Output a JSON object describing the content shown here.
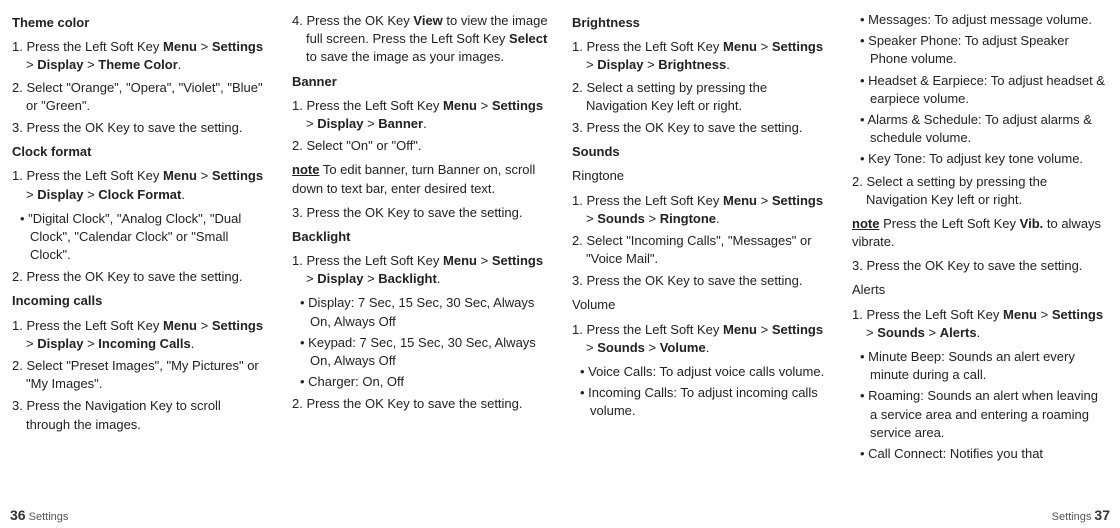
{
  "col1": {
    "themeColor": {
      "heading": "Theme color",
      "s1a": "1. Press the Left Soft Key ",
      "s1b": "Menu",
      "s1c": "Settings",
      "s1d": "Display",
      "s1e": "Theme Color",
      "s2": "2. Select \"Orange\", \"Opera\", \"Violet\", \"Blue\" or \"Green\".",
      "s3": "3. Press the OK Key to save the setting."
    },
    "clockFormat": {
      "heading": "Clock format",
      "s1a": "1. Press the Left Soft Key ",
      "s1b": "Menu",
      "s1c": "Settings",
      "s1d": "Display",
      "s1e": "Clock Format",
      "b1": "\"Digital Clock\", \"Analog Clock\", \"Dual Clock\", \"Calendar Clock\" or \"Small Clock\".",
      "s2": "2. Press the OK Key to save the setting."
    },
    "incoming": {
      "heading": "Incoming calls",
      "s1a": "1. Press the Left Soft Key ",
      "s1b": "Menu",
      "s1c": "Settings",
      "s1d": "Display",
      "s1e": "Incoming Calls",
      "s2": "2. Select \"Preset Images\", \"My Pictures\" or \"My Images\".",
      "s3": "3. Press the Navigation Key to scroll through the images."
    },
    "footerNum": "36",
    "footerText": "Settings"
  },
  "col2": {
    "s4a": "4. Press the OK Key ",
    "s4b": "View",
    "s4c": " to view the image full screen. Press the Left Soft Key ",
    "s4d": "Select",
    "s4e": " to save the image as your images.",
    "banner": {
      "heading": "Banner",
      "s1a": "1. Press the Left Soft Key ",
      "s1b": "Menu",
      "s1c": "Settings",
      "s1d": "Display",
      "s1e": "Banner",
      "s2": "2. Select \"On\" or \"Off\".",
      "noteLabel": "note",
      "noteText": " To edit banner, turn Banner on, scroll down to text bar, enter desired text.",
      "s3": "3. Press the OK Key to save the setting."
    },
    "backlight": {
      "heading": "Backlight",
      "s1a": "1. Press the Left Soft Key ",
      "s1b": "Menu",
      "s1c": "Settings",
      "s1d": "Display",
      "s1e": "Backlight",
      "b1": "Display: 7 Sec, 15 Sec, 30 Sec, Always On, Always Off",
      "b2": "Keypad: 7 Sec, 15 Sec, 30 Sec, Always On, Always Off",
      "b3": "Charger: On, Off",
      "s2": "2. Press the OK Key to save the setting."
    }
  },
  "col3": {
    "brightness": {
      "heading": "Brightness",
      "s1a": "1. Press the Left Soft Key ",
      "s1b": "Menu",
      "s1c": "Settings",
      "s1d": "Display",
      "s1e": "Brightness",
      "s2": "2. Select a setting by pressing the Navigation Key left or right.",
      "s3": "3. Press the OK Key to save the setting."
    },
    "sounds": {
      "heading": "Sounds"
    },
    "ringtone": {
      "heading": "Ringtone",
      "s1a": "1. Press the Left Soft Key ",
      "s1b": "Menu",
      "s1c": "Settings",
      "s1d": "Sounds",
      "s1e": "Ringtone",
      "s2": "2. Select \"Incoming Calls\", \"Messages\" or \"Voice Mail\".",
      "s3": "3. Press the OK Key to save the setting."
    },
    "volume": {
      "heading": "Volume",
      "s1a": "1. Press the Left Soft Key ",
      "s1b": "Menu",
      "s1c": "Settings",
      "s1d": "Sounds",
      "s1e": "Volume",
      "b1": "Voice Calls: To adjust voice calls volume.",
      "b2": "Incoming Calls: To adjust incoming calls volume."
    }
  },
  "col4": {
    "volCont": {
      "b3": "Messages: To adjust message volume.",
      "b4": "Speaker Phone: To adjust Speaker Phone volume.",
      "b5": "Headset & Earpiece: To adjust headset & earpiece volume.",
      "b6": "Alarms & Schedule: To adjust alarms & schedule volume.",
      "b7": "Key Tone: To adjust key tone volume."
    },
    "s2": "2. Select a setting by pressing the Navigation Key left or right.",
    "noteLabel": "note",
    "noteTextA": " Press the Left Soft Key ",
    "noteTextB": "Vib.",
    "noteTextC": " to always vibrate.",
    "s3": "3. Press the OK Key to save the setting.",
    "alerts": {
      "heading": "Alerts",
      "s1a": "1. Press the Left Soft Key ",
      "s1b": "Menu",
      "s1c": "Settings",
      "s1d": "Sounds",
      "s1e": "Alerts",
      "b1": "Minute Beep: Sounds an alert every minute during a call.",
      "b2": "Roaming: Sounds an alert when leaving a service area and entering a roaming service area.",
      "b3": "Call Connect: Notifies you that"
    },
    "footerText": "Settings",
    "footerNum": "37"
  }
}
